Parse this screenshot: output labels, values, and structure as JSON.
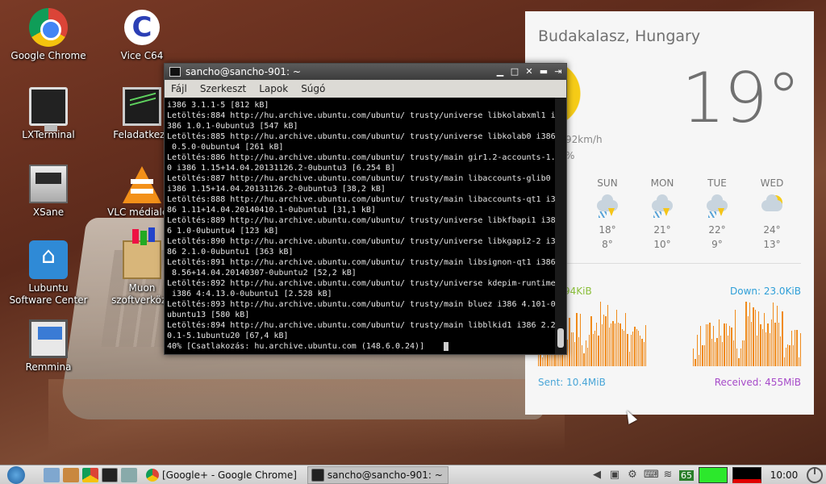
{
  "desktop": {
    "icons": [
      {
        "label": "Google Chrome"
      },
      {
        "label": "Vice C64"
      },
      {
        "label": "LXTerminal"
      },
      {
        "label": "Feladatkeze"
      },
      {
        "label": "XSane"
      },
      {
        "label": "VLC médialejá"
      },
      {
        "label": "Lubuntu\nSoftware Center"
      },
      {
        "label": "Muon\nszoftverközp"
      },
      {
        "label": "Remmina"
      }
    ]
  },
  "terminal": {
    "title": "sancho@sancho-901: ~",
    "menu": [
      "Fájl",
      "Szerkeszt",
      "Lapok",
      "Súgó"
    ],
    "lines": [
      "i386 3.1.1-5 [812 kB]",
      "Letöltés:884 http://hu.archive.ubuntu.com/ubuntu/ trusty/universe libkolabxml1 i",
      "386 1.0.1-0ubuntu3 [547 kB]",
      "Letöltés:885 http://hu.archive.ubuntu.com/ubuntu/ trusty/universe libkolab0 i386",
      " 0.5.0-0ubuntu4 [261 kB]",
      "Letöltés:886 http://hu.archive.ubuntu.com/ubuntu/ trusty/main gir1.2-accounts-1.",
      "0 i386 1.15+14.04.20131126.2-0ubuntu3 [6.254 B]",
      "Letöltés:887 http://hu.archive.ubuntu.com/ubuntu/ trusty/main libaccounts-glib0",
      "i386 1.15+14.04.20131126.2-0ubuntu3 [38,2 kB]",
      "Letöltés:888 http://hu.archive.ubuntu.com/ubuntu/ trusty/main libaccounts-qt1 i3",
      "86 1.11+14.04.20140410.1-0ubuntu1 [31,1 kB]",
      "Letöltés:889 http://hu.archive.ubuntu.com/ubuntu/ trusty/universe libkfbapi1 i38",
      "6 1.0-0ubuntu4 [123 kB]",
      "Letöltés:890 http://hu.archive.ubuntu.com/ubuntu/ trusty/universe libkgapi2-2 i3",
      "86 2.1.0-0ubuntu1 [363 kB]",
      "Letöltés:891 http://hu.archive.ubuntu.com/ubuntu/ trusty/main libsignon-qt1 i386",
      " 8.56+14.04.20140307-0ubuntu2 [52,2 kB]",
      "Letöltés:892 http://hu.archive.ubuntu.com/ubuntu/ trusty/universe kdepim-runtime",
      " i386 4:4.13.0-0ubuntu1 [2.528 kB]",
      "Letöltés:893 http://hu.archive.ubuntu.com/ubuntu/ trusty/main bluez i386 4.101-0",
      "ubuntu13 [580 kB]",
      "Letöltés:894 http://hu.archive.ubuntu.com/ubuntu/ trusty/main libblkid1 i386 2.2",
      "0.1-5.1ubuntu20 [67,4 kB]",
      "40% [Csatlakozás: hu.archive.ubuntu.com (148.6.0.24)]"
    ]
  },
  "weather": {
    "location": "Budakalasz, Hungary",
    "temperature": "19°",
    "wind": "92km/h",
    "humidity": "%",
    "forecast": [
      {
        "day": "SUN",
        "hi": "18°",
        "lo": "8°",
        "icon": "thunderstorm-icon"
      },
      {
        "day": "MON",
        "hi": "21°",
        "lo": "10°",
        "icon": "thunderstorm-icon"
      },
      {
        "day": "TUE",
        "hi": "22°",
        "lo": "9°",
        "icon": "thunderstorm-icon"
      },
      {
        "day": "WED",
        "hi": "24°",
        "lo": "13°",
        "icon": "partly-cloudy-icon"
      }
    ],
    "colors": {
      "sun": "#f6cc17",
      "graph": "#f08a1a"
    }
  },
  "network": {
    "up_label": "94KiB",
    "down_label": "Down: 23.0KiB",
    "sent": "Sent: 10.4MiB",
    "received": "Received: 455MiB"
  },
  "taskbar": {
    "tasks": [
      {
        "label": "[Google+ - Google Chrome]",
        "active": false
      },
      {
        "label": "sancho@sancho-901: ~",
        "active": true
      }
    ],
    "cpu": "65",
    "clock": "10:00"
  }
}
